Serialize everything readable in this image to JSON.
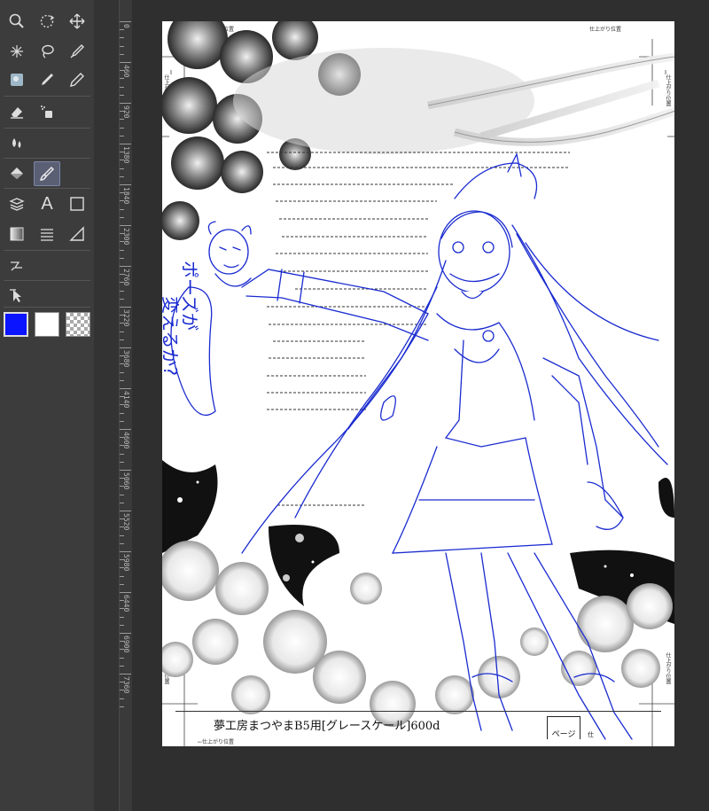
{
  "app": {
    "colors": {
      "main_color": "#0a14ff",
      "sub_color": "#ffffff",
      "ui_dark": "#3c3c3c",
      "sketch_blue": "#1a2bd0"
    }
  },
  "toolbar": {
    "tools": [
      {
        "name": "zoom",
        "icon": "magnifier-icon"
      },
      {
        "name": "rotate",
        "icon": "rotate-icon"
      },
      {
        "name": "move",
        "icon": "move-arrows-icon"
      },
      {
        "name": "auto-select",
        "icon": "magic-wand-icon"
      },
      {
        "name": "lasso",
        "icon": "lasso-icon"
      },
      {
        "name": "eyedropper",
        "icon": "eyedropper-icon"
      },
      {
        "name": "blend",
        "icon": "blend-icon"
      },
      {
        "name": "pen",
        "icon": "pen-icon"
      },
      {
        "name": "pencil",
        "icon": "pencil-icon"
      },
      {
        "name": "eraser",
        "icon": "eraser-icon"
      },
      {
        "name": "airbrush",
        "icon": "airbrush-icon"
      },
      {
        "name": "decoration",
        "icon": "water-drops-icon"
      },
      {
        "name": "fill",
        "icon": "fill-bucket-icon"
      },
      {
        "name": "sub-pen",
        "icon": "brush-icon",
        "selected": true
      },
      {
        "name": "layer-move",
        "icon": "layer-move-icon"
      },
      {
        "name": "text",
        "icon": "text-icon",
        "label": "A"
      },
      {
        "name": "frame",
        "icon": "frame-icon"
      },
      {
        "name": "gradient",
        "icon": "gradient-icon"
      },
      {
        "name": "hatching",
        "icon": "lines-icon"
      },
      {
        "name": "ruler",
        "icon": "ruler-icon"
      },
      {
        "name": "correct-line",
        "icon": "correct-line-icon"
      },
      {
        "name": "operation",
        "icon": "operation-arrow-icon"
      }
    ]
  },
  "ruler": {
    "labels": [
      "0",
      "460",
      "920",
      "1380",
      "1840",
      "2300",
      "2760",
      "3220",
      "3680",
      "4140",
      "4600",
      "5060",
      "5520",
      "5980",
      "6440",
      "6900",
      "7360"
    ]
  },
  "page": {
    "trim_label": "←仕上がり位置",
    "trim_label_right": "仕上がり位置",
    "trim_label_vertical": "仕上がり位置",
    "footer_template": "夢工房まつやまB5用[グレースケール]600d",
    "page_box": "ページ",
    "corner_char": "仕",
    "speech_text_a": "ポーズが",
    "speech_text_b": "変えるか?"
  }
}
